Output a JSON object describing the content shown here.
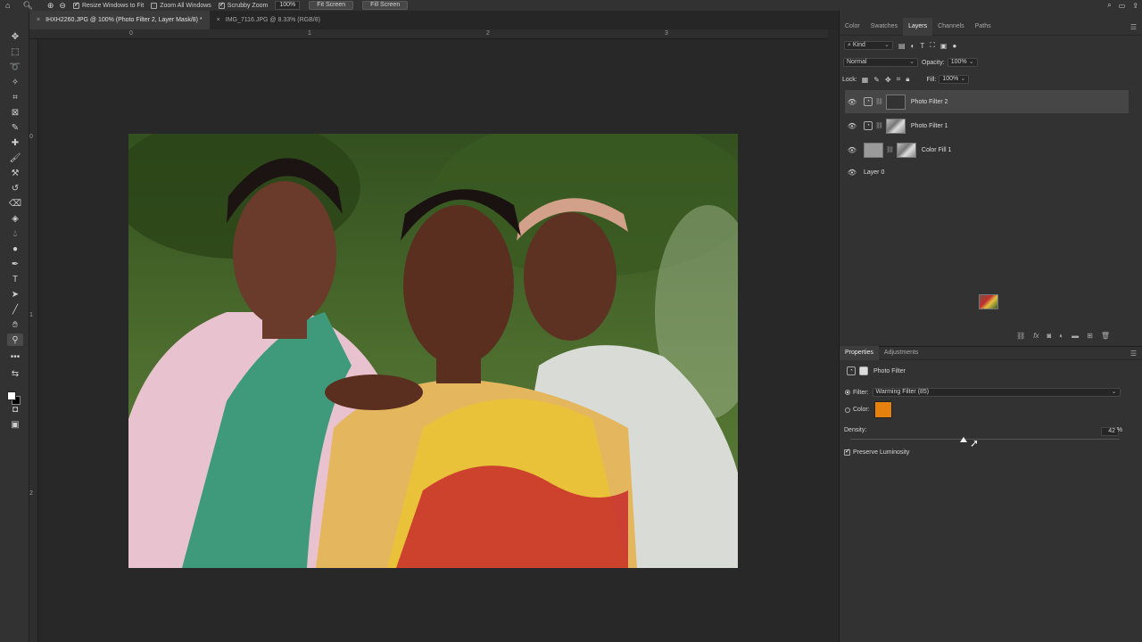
{
  "optbar": {
    "resize_windows": "Resize Windows to Fit",
    "zoom_all": "Zoom All Windows",
    "scrubby_zoom": "Scrubby Zoom",
    "zoom_value": "100%",
    "fit_screen": "Fit Screen",
    "fill_screen": "Fill Screen"
  },
  "tabs": [
    {
      "label": "IHXH2260.JPG @ 100% (Photo Filter 2, Layer Mask/8) *"
    },
    {
      "label": "IMG_7116.JPG @ 8.33% (RGB/8)"
    }
  ],
  "ruler": {
    "h": [
      "0",
      "1",
      "2",
      "3"
    ],
    "v": [
      "0",
      "1",
      "2"
    ]
  },
  "layers_panel": {
    "tabs": [
      "Color",
      "Swatches",
      "Layers",
      "Channels",
      "Paths"
    ],
    "active_tab": "Layers",
    "filter_kind": "Kind",
    "blend_mode": "Normal",
    "opacity_label": "Opacity:",
    "opacity_value": "100%",
    "lock_label": "Lock:",
    "fill_label": "Fill:",
    "fill_value": "100%",
    "layers": [
      {
        "name": "Photo Filter 2",
        "selected": true
      },
      {
        "name": "Photo Filter 1",
        "selected": false
      },
      {
        "name": "Color Fill 1",
        "selected": false
      },
      {
        "name": "Layer 0",
        "selected": false
      }
    ]
  },
  "properties_panel": {
    "tabs": [
      "Properties",
      "Adjustments"
    ],
    "active_tab": "Properties",
    "title": "Photo Filter",
    "filter_label": "Filter:",
    "filter_value": "Warming Filter (85)",
    "color_label": "Color:",
    "color_hex": "#E7810D",
    "density_label": "Density:",
    "density_value": "42",
    "density_unit": "%",
    "density_fraction": 0.42,
    "preserve_luminosity": "Preserve Luminosity",
    "preserve_checked": true
  }
}
